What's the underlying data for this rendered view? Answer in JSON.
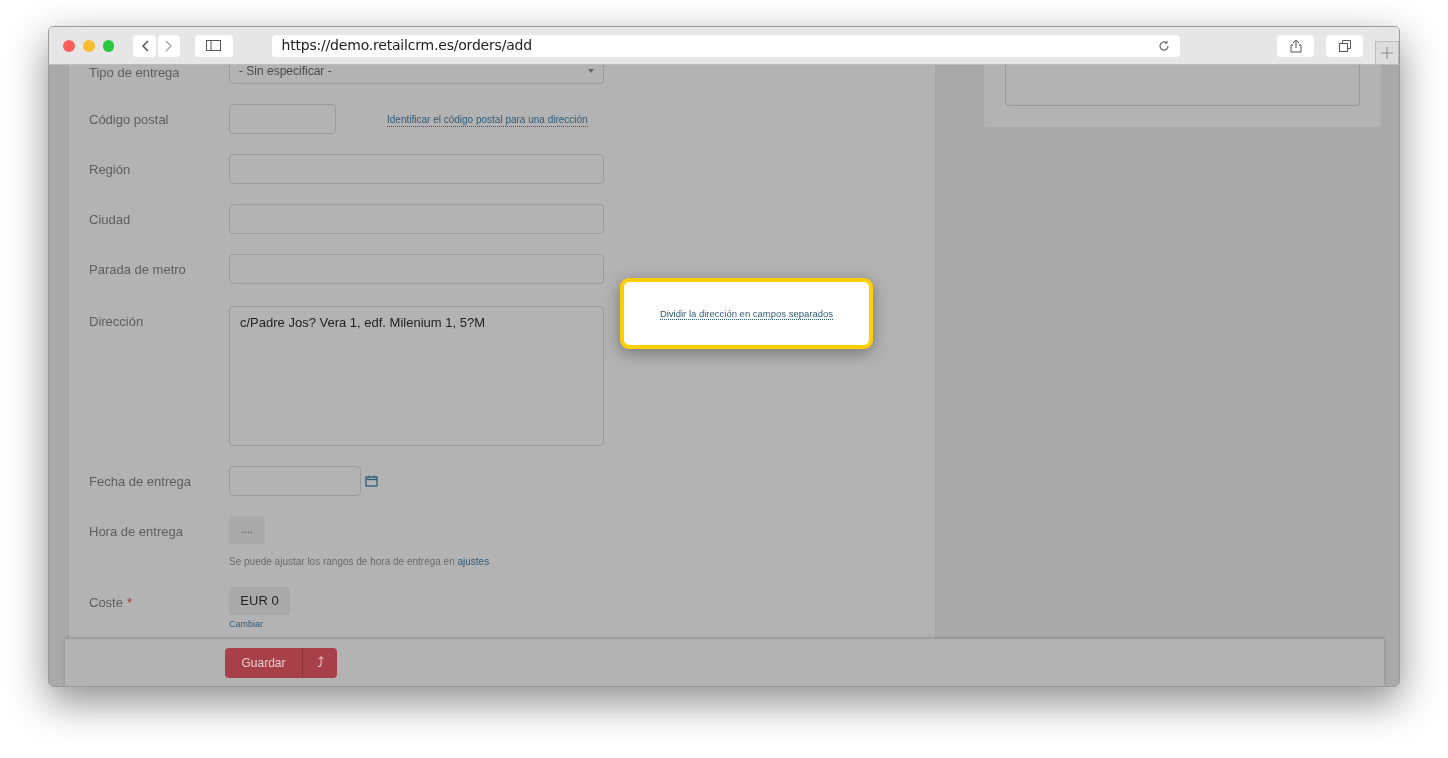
{
  "browser": {
    "url": "https://demo.retailcrm.es/orders/add"
  },
  "fields": [
    {
      "kind": "select",
      "label": "Tipo de entrega",
      "value": "- Sin especificar -"
    },
    {
      "kind": "short",
      "label": "Código postal",
      "link": "Identificar el código postal para una dirección"
    },
    {
      "kind": "input",
      "label": "Región"
    },
    {
      "kind": "input",
      "label": "Ciudad"
    },
    {
      "kind": "input",
      "label": "Parada de metro"
    },
    {
      "kind": "textarea",
      "label": "Dirección",
      "value": "c/Padre Jos? Vera 1, edf. Milenium 1, 5?M"
    },
    {
      "kind": "date",
      "label": "Fecha de entrega"
    },
    {
      "kind": "time",
      "label": "Hora de entrega",
      "value": "....",
      "note": "Se puede ajustar los rangos de hora de entrega en",
      "note_link": "ajustes"
    },
    {
      "kind": "price",
      "label": "Coste",
      "required_mark": "*",
      "value": "EUR 0",
      "link": "Cambiar"
    }
  ],
  "popup": {
    "link": "Dividir la dirección en campos separados"
  },
  "footer": {
    "save": "Guardar",
    "menu": "⤴"
  }
}
